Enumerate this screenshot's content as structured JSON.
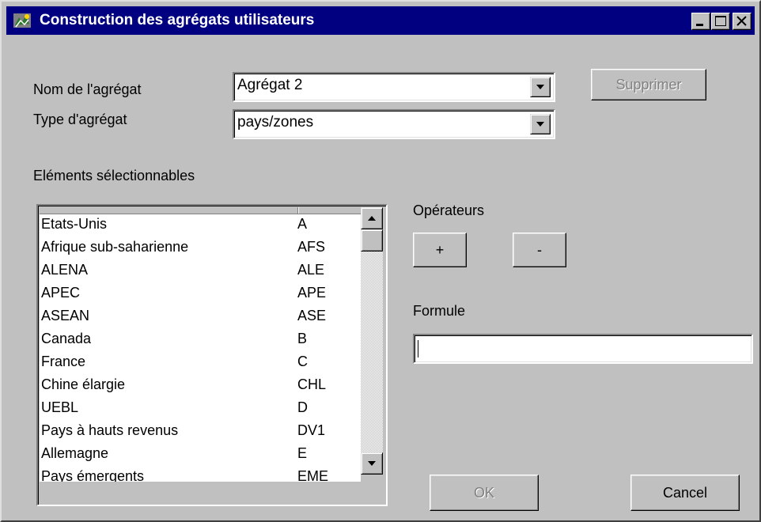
{
  "window": {
    "title": "Construction des agrégats utilisateurs",
    "icons": {
      "app": "app-icon",
      "minimize": "minimize-icon",
      "maximize": "maximize-icon",
      "close": "close-icon"
    }
  },
  "form": {
    "name_label": "Nom de l'agrégat",
    "name_value": "Agrégat  2",
    "type_label": "Type d'agrégat",
    "type_value": "pays/zones",
    "delete_button": "Supprimer",
    "selectable_label": "Eléments sélectionnables"
  },
  "list": {
    "items": [
      {
        "name": "Etats-Unis",
        "code": "A"
      },
      {
        "name": "Afrique sub-saharienne",
        "code": "AFS"
      },
      {
        "name": "ALENA",
        "code": "ALE"
      },
      {
        "name": "APEC",
        "code": "APE"
      },
      {
        "name": "ASEAN",
        "code": "ASE"
      },
      {
        "name": "Canada",
        "code": "B"
      },
      {
        "name": "France",
        "code": "C"
      },
      {
        "name": "Chine élargie",
        "code": "CHL"
      },
      {
        "name": "UEBL",
        "code": "D"
      },
      {
        "name": "Pays à hauts revenus",
        "code": "DV1"
      },
      {
        "name": "Allemagne",
        "code": "E"
      },
      {
        "name": "Pays émergents",
        "code": "EME"
      }
    ]
  },
  "operators": {
    "label": "Opérateurs",
    "plus": "+",
    "minus": "-"
  },
  "formula": {
    "label": "Formule",
    "value": ""
  },
  "buttons": {
    "ok": "OK",
    "cancel": "Cancel"
  },
  "colors": {
    "titlebar": "#000080",
    "face": "#c0c0c0"
  }
}
